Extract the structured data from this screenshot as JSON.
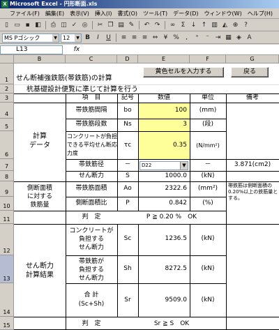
{
  "window": {
    "title": "Microsoft Excel - 円形断面.xls"
  },
  "menu": [
    "ファイル(F)",
    "編集(E)",
    "表示(V)",
    "挿入(I)",
    "書式(O)",
    "ツール(T)",
    "データ(D)",
    "ウィンドウ(W)",
    "ヘルプ(H)"
  ],
  "format_toolbar": {
    "font": "MS Pゴシック",
    "size": "12",
    "bold": "B",
    "italic": "I",
    "underline": "U"
  },
  "formula_bar": {
    "cell": "L13",
    "fx": "fx",
    "content": ""
  },
  "columns": [
    "B",
    "C",
    "D",
    "E",
    "F",
    "G"
  ],
  "rows": [
    "1",
    "2",
    "3",
    "4",
    "5",
    "6",
    "7",
    "8",
    "9",
    "10",
    "11",
    "12",
    "13",
    "14",
    "15"
  ],
  "sheet": {
    "title": "せん断補強鉄筋(帯鉄筋)の計算",
    "subtitle": "杭基礎設計便覧に準じて計算を行う",
    "button_yellow": "黄色セルを入力する",
    "button_back": "戻る",
    "headers": {
      "item": "項　目",
      "symbol": "記号",
      "value": "数値",
      "unit": "単位",
      "note": "備考"
    },
    "calc_group": "計算\nデータ",
    "calc_rows": [
      {
        "item": "帯鉄筋間隔",
        "symbol": "bo",
        "value": "100",
        "unit": "(mm)"
      },
      {
        "item": "帯鉄筋段数",
        "symbol": "Ns",
        "value": "3",
        "unit": "(段)"
      },
      {
        "item": "コンクリートが負担できる平均せん断応力度",
        "symbol": "τc",
        "value": "0.35",
        "unit": "(N/mm²)"
      },
      {
        "item": "帯鉄筋径",
        "symbol": "－",
        "value": "D22",
        "unit": "－",
        "note": "3.871(cm2)"
      },
      {
        "item": "せん断力",
        "symbol": "S",
        "value": "1000.0",
        "unit": "(kN)"
      }
    ],
    "side_group": "側断面積\nに対する\n鉄筋量",
    "side_rows": [
      {
        "item": "帯鉄筋面積",
        "symbol": "Ao",
        "value": "2322.6",
        "unit": "(mm²)"
      },
      {
        "item": "側断面積比",
        "symbol": "P",
        "value": "0.842",
        "unit": "(%)"
      }
    ],
    "side_note": "帯鉄筋は側断面積の0.20%以上の鉄筋量とする。",
    "judge1_label": "判　定",
    "judge1_value": "P ≧ 0.20 %　OK",
    "shear_group": "せん断力\n計算結果",
    "shear_rows": [
      {
        "item": "コンクリートが\n負担する\nせん断力",
        "symbol": "Sc",
        "value": "1236.5",
        "unit": "(kN)"
      },
      {
        "item": "帯鉄筋が\n負担する\nせん断力",
        "symbol": "Sh",
        "value": "8272.5",
        "unit": "(kN)"
      },
      {
        "item": "合 計\n(Sc+Sh)",
        "symbol": "Sr",
        "value": "9509.0",
        "unit": "(kN)"
      }
    ],
    "judge2_label": "判　定",
    "judge2_value": "Sr ≧ S　OK"
  },
  "colors": {
    "input_yellow": "#ffff99",
    "titlebar": "#0a246a"
  }
}
